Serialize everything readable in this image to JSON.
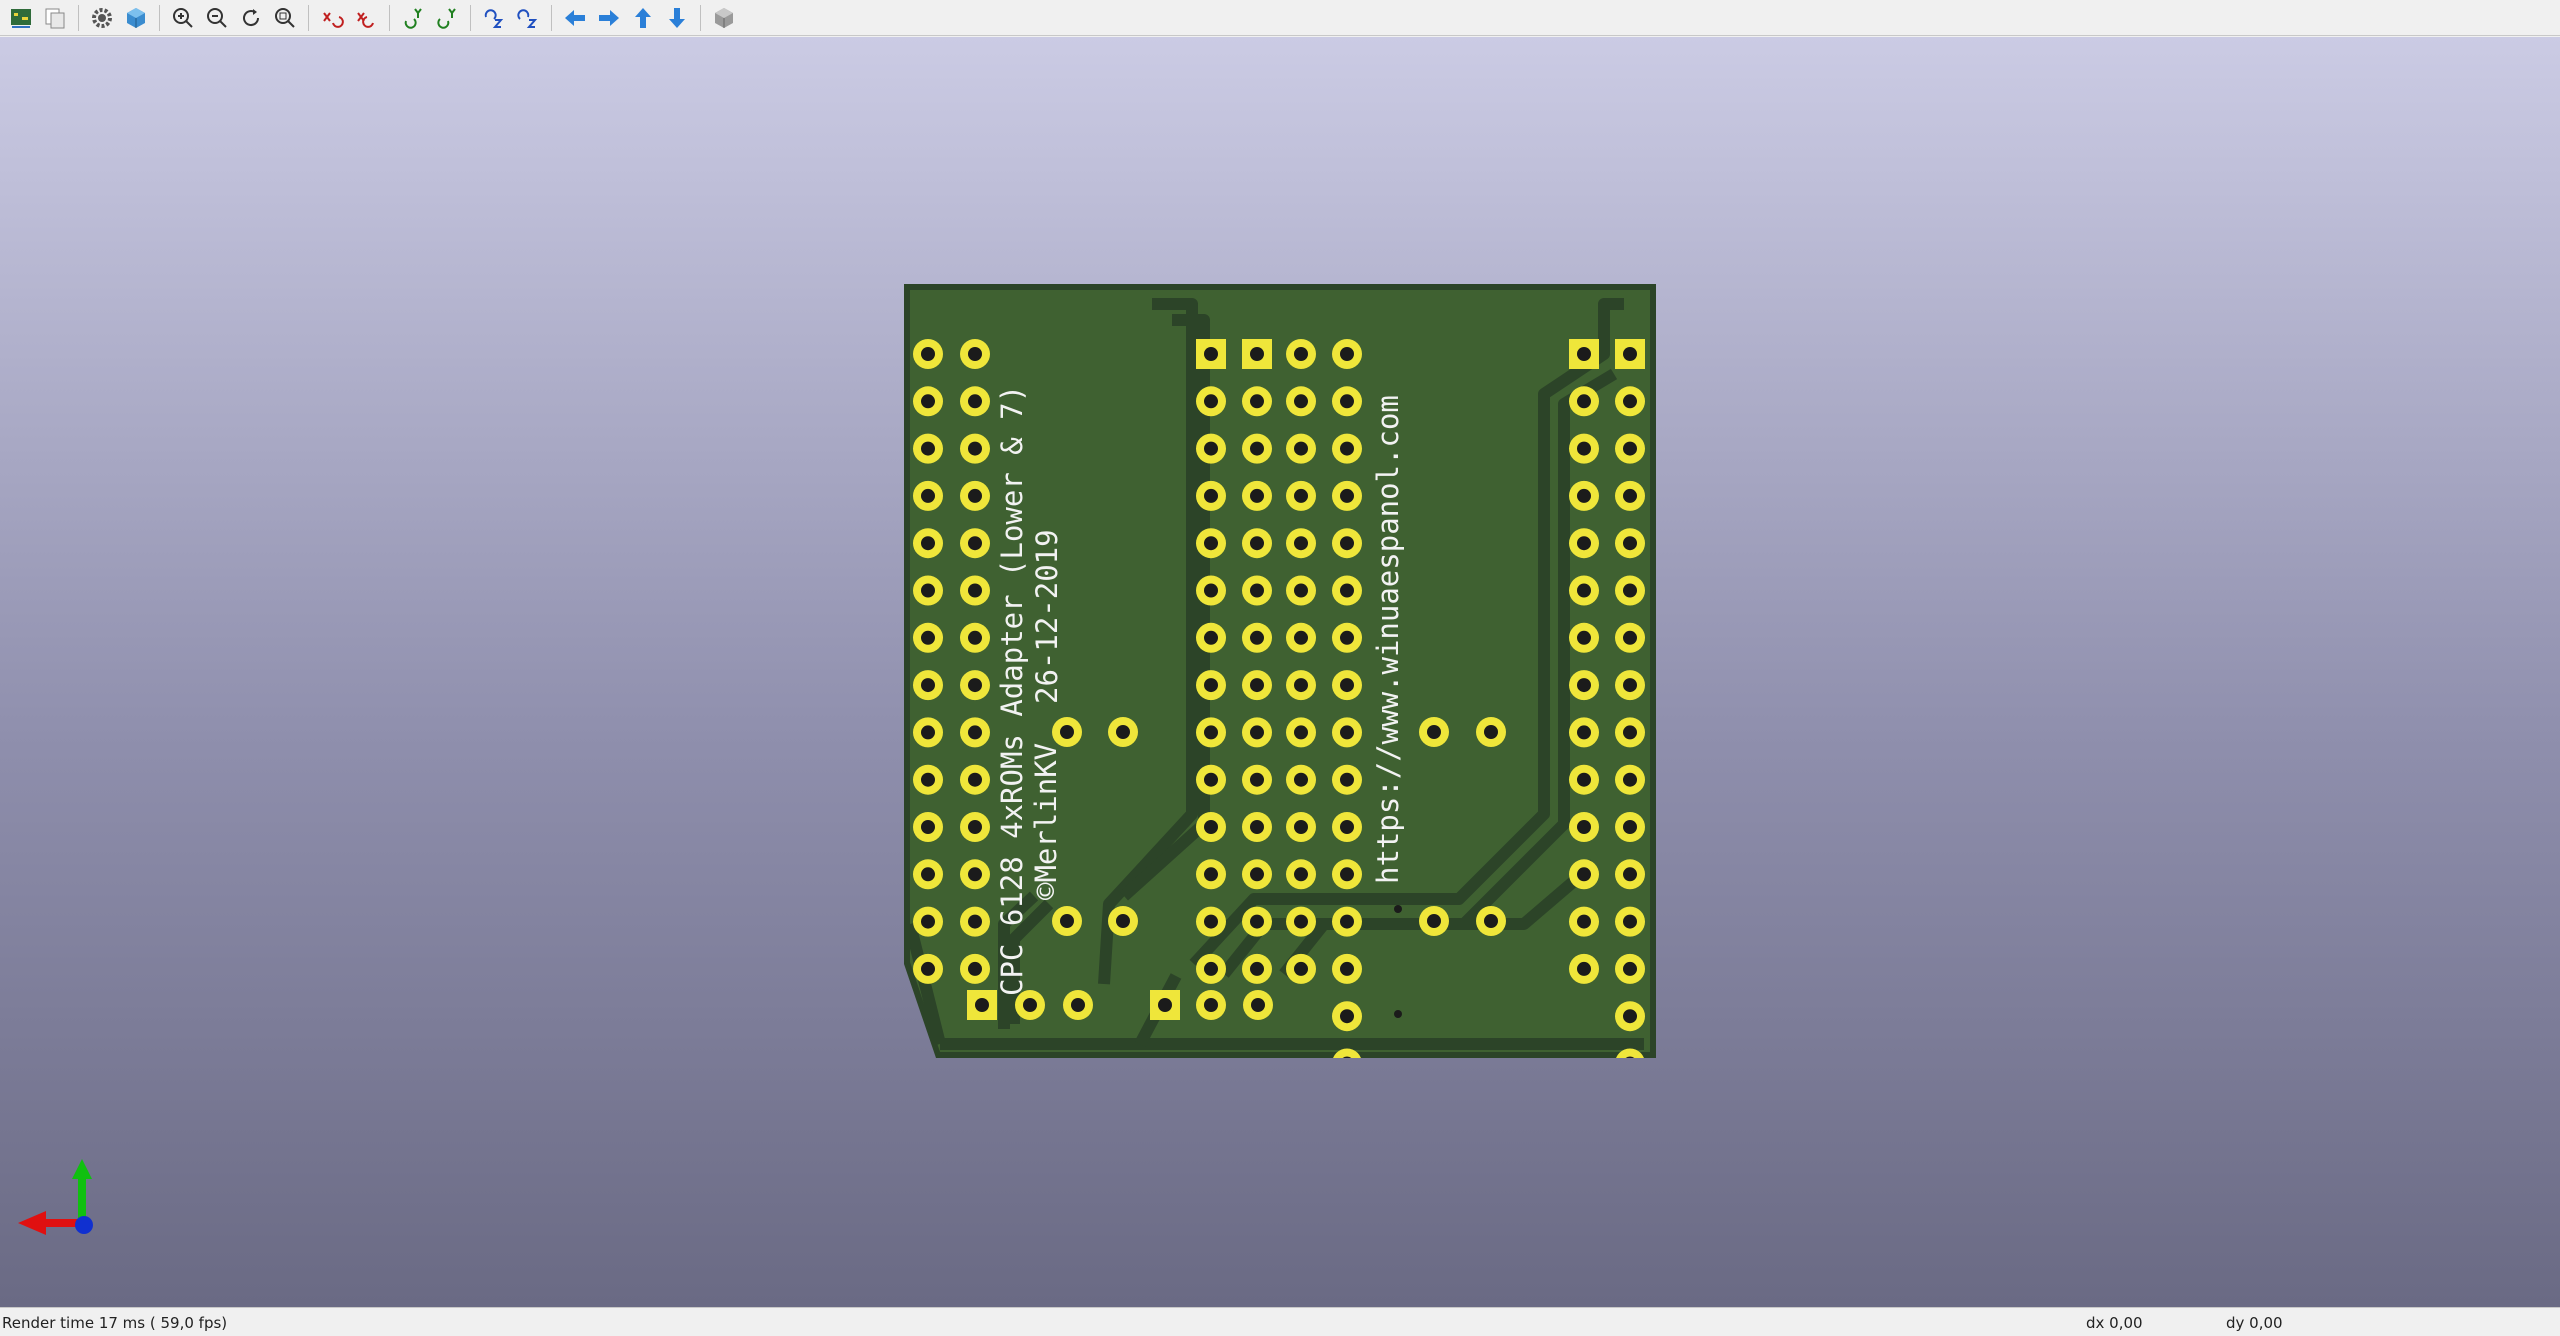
{
  "toolbar": {
    "buttons": [
      {
        "id": "reload",
        "icon": "reload-board-icon"
      },
      {
        "id": "copy",
        "icon": "copy-image-icon"
      },
      {
        "id": "prefs",
        "icon": "gear-icon"
      },
      {
        "id": "raytrace",
        "icon": "render-cube-icon"
      },
      {
        "id": "zoom-in",
        "icon": "zoom-in-icon"
      },
      {
        "id": "zoom-out",
        "icon": "zoom-out-icon"
      },
      {
        "id": "redraw",
        "icon": "redraw-icon"
      },
      {
        "id": "zoom-fit",
        "icon": "zoom-fit-icon"
      },
      {
        "id": "rot-x-cw",
        "icon": "rotate-x-cw-icon"
      },
      {
        "id": "rot-x-ccw",
        "icon": "rotate-x-ccw-icon"
      },
      {
        "id": "rot-y-cw",
        "icon": "rotate-y-cw-icon"
      },
      {
        "id": "rot-y-ccw",
        "icon": "rotate-y-ccw-icon"
      },
      {
        "id": "rot-z-cw",
        "icon": "rotate-z-cw-icon"
      },
      {
        "id": "rot-z-ccw",
        "icon": "rotate-z-ccw-icon"
      },
      {
        "id": "move-left",
        "icon": "arrow-left-icon"
      },
      {
        "id": "move-right",
        "icon": "arrow-right-icon"
      },
      {
        "id": "move-up",
        "icon": "arrow-up-icon"
      },
      {
        "id": "move-down",
        "icon": "arrow-down-icon"
      },
      {
        "id": "ortho",
        "icon": "ortho-cube-icon"
      }
    ]
  },
  "board": {
    "silkscreen_main": "CPC 6128 4xROMs Adapter (Lower & 7)",
    "silkscreen_date": "26-12-2019",
    "silkscreen_author": "©MerlinKV",
    "silkscreen_url": "https://www.winuaespanol.com",
    "colors": {
      "soldermask": "#3f6131",
      "board_edge": "#2c4428",
      "pad": "#efe63a",
      "hole": "#1b1b1b",
      "silk": "#f2f2f2"
    }
  },
  "axis": {
    "x_color": "#e01010",
    "y_color": "#10c010",
    "z_color": "#1030d0"
  },
  "status": {
    "render_time": "Render time 17 ms ( 59,0 fps)",
    "dx": "dx 0,00",
    "dy": "dy 0,00"
  }
}
